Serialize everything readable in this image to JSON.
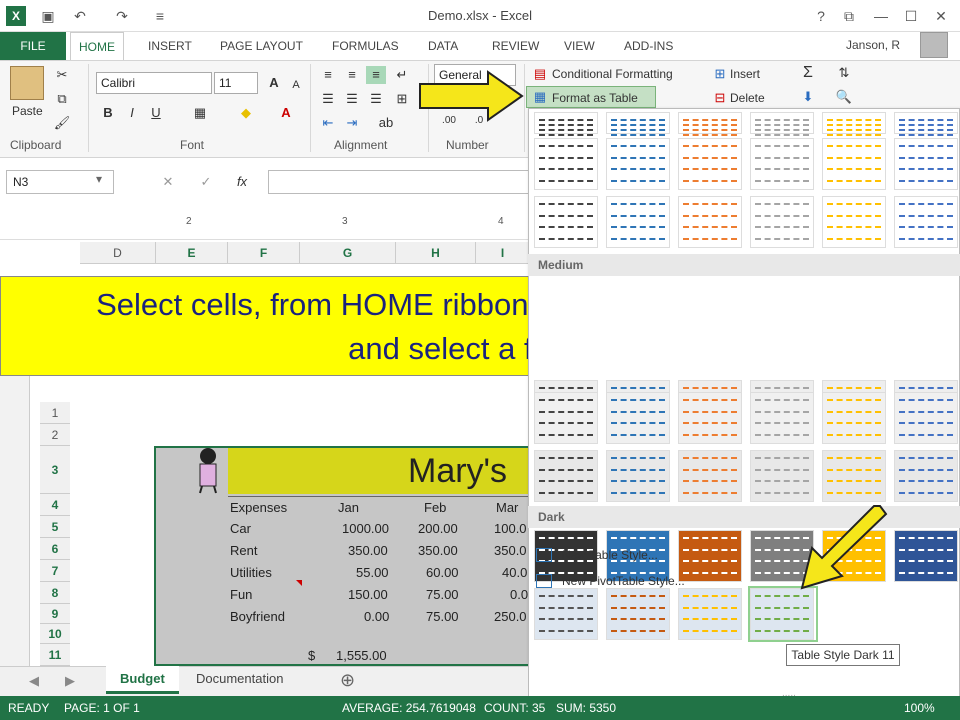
{
  "window": {
    "title": "Demo.xlsx - Excel",
    "help": "?",
    "restore": "⧉",
    "minimize": "—",
    "maximize": "☐",
    "close": "✕"
  },
  "qat": {
    "excel": "X",
    "save": "💾",
    "undo": "↶",
    "redo": "↷",
    "more": "≡"
  },
  "tabs": {
    "file": "FILE",
    "home": "HOME",
    "insert": "INSERT",
    "page_layout": "PAGE LAYOUT",
    "formulas": "FORMULAS",
    "data": "DATA",
    "review": "REVIEW",
    "view": "VIEW",
    "addins": "ADD-INS"
  },
  "user": "Janson, R",
  "ribbon": {
    "clipboard": {
      "paste": "Paste",
      "label": "Clipboard"
    },
    "font": {
      "name": "Calibri",
      "size": "11",
      "label": "Font",
      "bold": "B",
      "italic": "I",
      "underline": "U",
      "grow": "A",
      "shrink": "A",
      "fontcolor": "A"
    },
    "alignment": {
      "label": "Alignment"
    },
    "number": {
      "format": "General",
      "label": "Number",
      "dec_inc": ".00",
      "dec_dec": ".0"
    },
    "styles": {
      "cond": "Conditional Formatting",
      "format_table": "Format as Table"
    },
    "cells": {
      "insert": "Insert",
      "delete": "Delete"
    }
  },
  "namebox": "N3",
  "ruler": {
    "m2": "2",
    "m3": "3",
    "m4": "4"
  },
  "columns": [
    "D",
    "E",
    "F",
    "G",
    "H",
    "I"
  ],
  "banner": {
    "line1": "Select cells, from HOME ribbon display Format as Table",
    "line2": "and select a format"
  },
  "rows": [
    "1",
    "2",
    "3",
    "4",
    "5",
    "6",
    "7",
    "8",
    "9",
    "10",
    "11"
  ],
  "sheet": {
    "title": "Mary's",
    "headers": [
      "Expenses",
      "Jan",
      "Feb",
      "Mar"
    ],
    "data": [
      [
        "Car",
        "1000.00",
        "200.00",
        "100.0"
      ],
      [
        "Rent",
        "350.00",
        "350.00",
        "350.0"
      ],
      [
        "Utilities",
        "55.00",
        "60.00",
        "40.0"
      ],
      [
        "Fun",
        "150.00",
        "75.00",
        "0.0"
      ],
      [
        "Boyfriend",
        "0.00",
        "75.00",
        "250.0"
      ]
    ],
    "total_symbol": "$",
    "total": "1,555.00"
  },
  "gallery": {
    "medium": "Medium",
    "dark": "Dark",
    "new_table": "New Table Style...",
    "new_pivot": "New PivotTable Style...",
    "more": "....."
  },
  "tooltip": "Table Style Dark 11",
  "sheettabs": {
    "budget": "Budget",
    "documentation": "Documentation",
    "add": "⊕"
  },
  "status": {
    "ready": "READY",
    "page": "PAGE: 1 OF 1",
    "average": "AVERAGE: 254.7619048",
    "count": "COUNT: 35",
    "sum": "SUM: 5350",
    "zoom": "100%"
  },
  "colors": {
    "excel_green": "#217346",
    "banner_yellow": "#ffff00",
    "banner_text": "#1a237e",
    "arrow": "#f5e61a"
  }
}
